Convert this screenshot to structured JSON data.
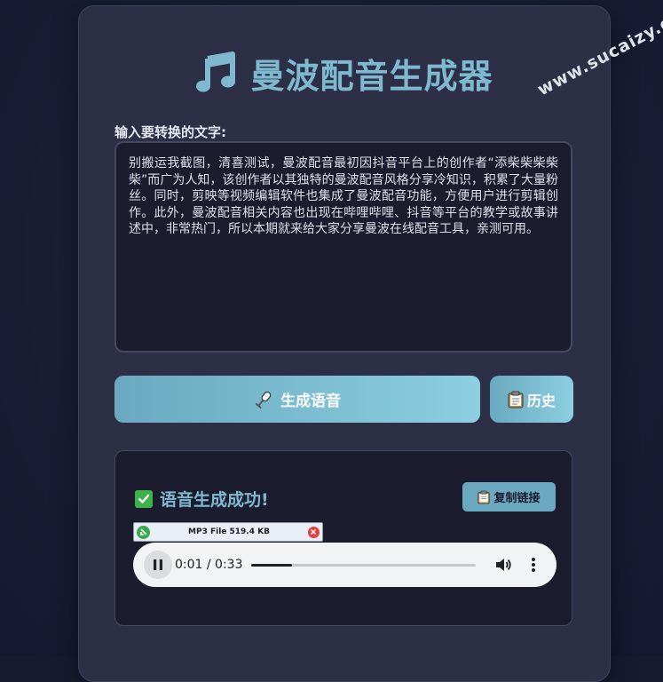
{
  "app": {
    "title": "曼波配音生成器",
    "watermark": "www.sucaizy.com"
  },
  "input": {
    "label": "输入要转换的文字:",
    "text": "别搬运我截图，清喜测试，曼波配音最初因抖音平台上的创作者“添柴柴柴柴柴”而广为人知，该创作者以其独特的曼波配音风格分享冷知识，积累了大量粉丝。同时，剪映等视频编辑软件也集成了曼波配音功能，方便用户进行剪辑创作。此外，曼波配音相关内容也出现在哔哩哔哩、抖音等平台的教学或故事讲述中，非常热门，所以本期就来给大家分享曼波在线配音工具，亲测可用。"
  },
  "buttons": {
    "generate_label": "生成语音",
    "history_label": "历史",
    "copy_label": "复制链接"
  },
  "result": {
    "status_text": "语音生成成功!",
    "download_label": "MP3 File 519.4 KB"
  },
  "player": {
    "time": "0:01 / 0:33",
    "progress": 0.18
  },
  "colors": {
    "accent": "#7fb9cf",
    "button_gradient_start": "#6aa9bf",
    "button_gradient_end": "#8ccfe0",
    "card": "#2c2f45",
    "panel": "#1b1c2e",
    "success_green": "#3bb34a"
  },
  "icons": {
    "title": "music-note-icon",
    "generate": "microphone-icon",
    "history": "clipboard-icon",
    "copy": "clipboard-icon",
    "success": "checkmark-icon"
  }
}
